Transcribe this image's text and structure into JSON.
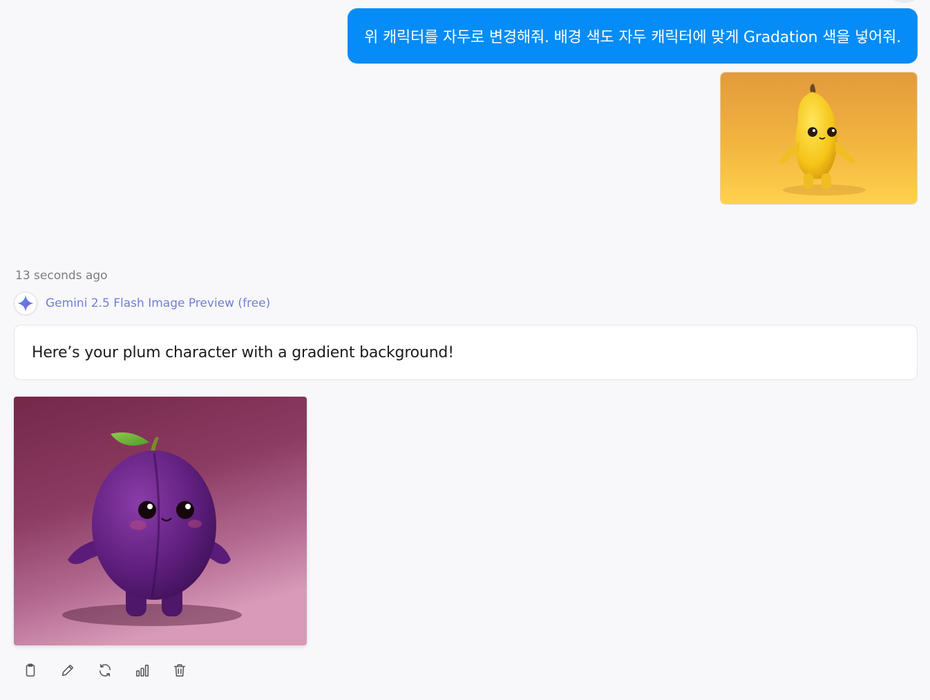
{
  "user_message": {
    "text": "위 캐릭터를 자두로 변경해줘. 배경 색도 자두 캐릭터에 맞게 Gradation 색을 넣어줘.",
    "attachment_icon": "banana-character-image"
  },
  "assistant": {
    "timestamp": "13 seconds ago",
    "model_name": "Gemini 2.5 Flash Image Preview (free)",
    "model_icon": "gemini-sparkle-icon",
    "message": "Here’s your plum character with a gradient background!",
    "result_image": "plum-character-image"
  },
  "actions": [
    {
      "name": "copy-button",
      "icon": "clipboard-icon"
    },
    {
      "name": "edit-button",
      "icon": "pencil-icon"
    },
    {
      "name": "regenerate-button",
      "icon": "refresh-icon"
    },
    {
      "name": "stats-button",
      "icon": "bar-chart-icon"
    },
    {
      "name": "delete-button",
      "icon": "trash-icon"
    }
  ],
  "colors": {
    "user_bubble": "#058cf6",
    "model_name": "#6f7fd4",
    "background": "#f8f8fa"
  }
}
